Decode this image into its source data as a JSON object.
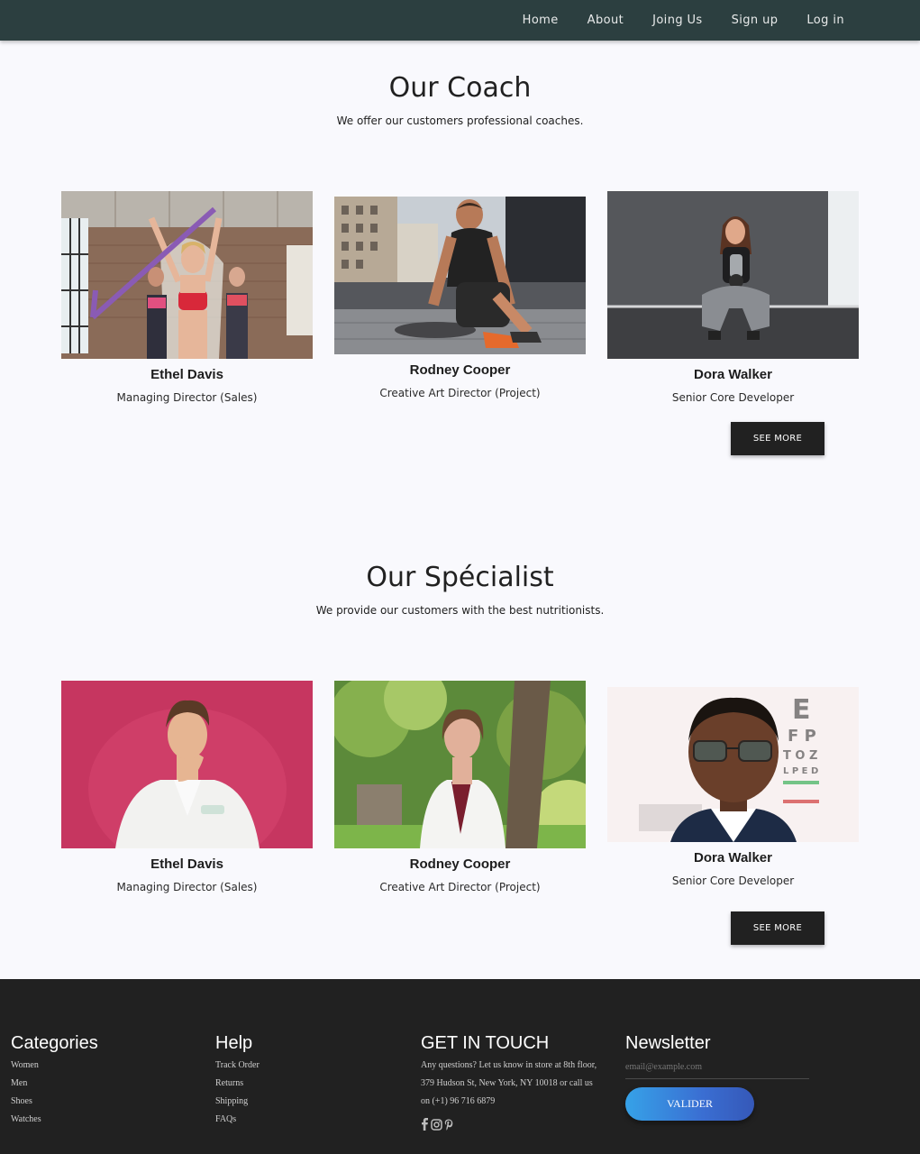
{
  "nav": {
    "items": [
      {
        "label": "Home"
      },
      {
        "label": "About"
      },
      {
        "label": "Joing Us"
      },
      {
        "label": "Sign up"
      },
      {
        "label": "Log in"
      }
    ]
  },
  "coach": {
    "title": "Our Coach",
    "subtitle": "We offer our customers professional coaches.",
    "cards": [
      {
        "name": "Ethel Davis",
        "role": "Managing Director (Sales)"
      },
      {
        "name": "Rodney Cooper",
        "role": "Creative Art Director (Project)"
      },
      {
        "name": "Dora Walker",
        "role": "Senior Core Developer"
      }
    ],
    "button": "SEE MORE"
  },
  "specialist": {
    "title": "Our Spécialist",
    "subtitle": "We provide our customers with the best nutritionists.",
    "cards": [
      {
        "name": "Ethel Davis",
        "role": "Managing Director (Sales)"
      },
      {
        "name": "Rodney Cooper",
        "role": "Creative Art Director (Project)"
      },
      {
        "name": "Dora Walker",
        "role": "Senior Core Developer"
      }
    ],
    "button": "SEE MORE"
  },
  "footer": {
    "categories": {
      "title": "Categories",
      "links": [
        "Women",
        "Men",
        "Shoes",
        "Watches"
      ]
    },
    "help": {
      "title": "Help",
      "links": [
        "Track Order",
        "Returns",
        "Shipping",
        "FAQs"
      ]
    },
    "contact": {
      "title": "GET IN TOUCH",
      "lines": [
        "Any questions? Let us know in store at 8th floor,",
        "379 Hudson St, New York, NY 10018 or call us",
        "on (+1) 96 716 6879"
      ],
      "social_icons": [
        "facebook-icon",
        "instagram-icon",
        "pinterest-icon"
      ]
    },
    "newsletter": {
      "title": "Newsletter",
      "placeholder": "email@example.com",
      "button": "VALIDER"
    }
  }
}
